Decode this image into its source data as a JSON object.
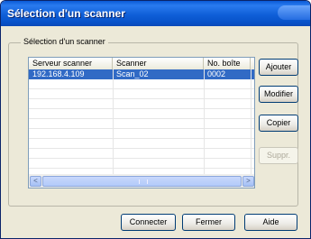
{
  "window": {
    "title": "Sélection d'un scanner"
  },
  "group": {
    "label": "Sélection d'un scanner"
  },
  "table": {
    "columns": [
      "Serveur scanner",
      "Scanner",
      "No. boîte"
    ],
    "rows": [
      {
        "server": "192.168.4.109",
        "scanner": "Scan_02",
        "box": "0002",
        "selected": true
      }
    ]
  },
  "side_buttons": {
    "add": "Ajouter",
    "modify": "Modifier",
    "copy": "Copier",
    "delete": "Suppr."
  },
  "bottom_buttons": {
    "connect": "Connecter",
    "close": "Fermer",
    "help": "Aide"
  },
  "scrollbar": {
    "left_arrow": "<",
    "right_arrow": ">"
  }
}
